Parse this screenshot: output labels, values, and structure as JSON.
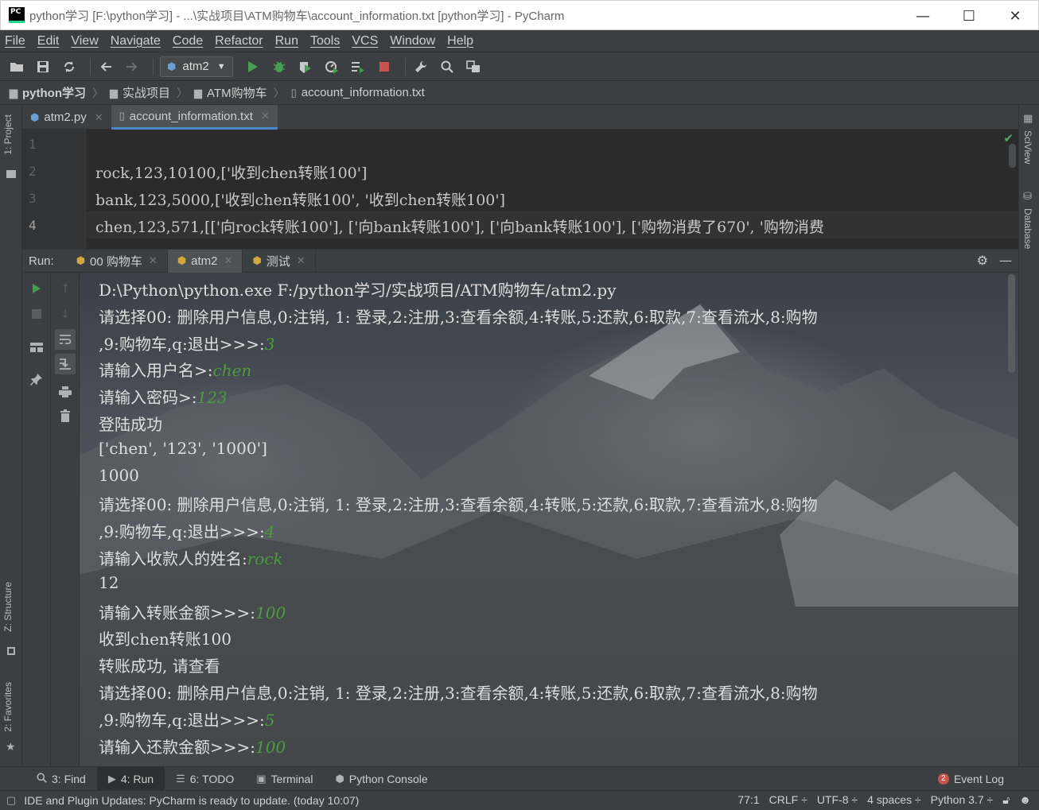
{
  "window": {
    "title": "python学习 [F:\\python学习] - ...\\实战项目\\ATM购物车\\account_information.txt [python学习] - PyCharm",
    "app_icon_text": "PC",
    "minimize": "—",
    "maximize": "☐",
    "close": "✕"
  },
  "menu": [
    "File",
    "Edit",
    "View",
    "Navigate",
    "Code",
    "Refactor",
    "Run",
    "Tools",
    "VCS",
    "Window",
    "Help"
  ],
  "toolbar": {
    "run_config": "atm2"
  },
  "breadcrumb": [
    "python学习",
    "实战项目",
    "ATM购物车",
    "account_information.txt"
  ],
  "left_strip": {
    "project": "1: Project",
    "structure": "Z: Structure",
    "favorites": "2: Favorites"
  },
  "right_strip": {
    "sciview": "SciView",
    "database": "Database"
  },
  "editor_tabs": [
    {
      "label": "atm2.py",
      "active": false
    },
    {
      "label": "account_information.txt",
      "active": true
    }
  ],
  "editor": {
    "line_numbers": [
      "1",
      "2",
      "3",
      "4"
    ],
    "lines": [
      "",
      "rock,123,10100,['收到chen转账100']",
      "bank,123,5000,['收到chen转账100', '收到chen转账100']",
      "chen,123,571,[['向rock转账100'], ['向bank转账100'], ['向bank转账100'], ['购物消费了670', '购物消费"
    ]
  },
  "run_panel": {
    "label": "Run:",
    "tabs": [
      {
        "label": "00 购物车",
        "active": false
      },
      {
        "label": "atm2",
        "active": true
      },
      {
        "label": "测试",
        "active": false
      }
    ]
  },
  "console": [
    {
      "text": "D:\\Python\\python.exe F:/python学习/实战项目/ATM购物车/atm2.py",
      "input": ""
    },
    {
      "text": "请选择00: 删除用户信息,0:注销, 1: 登录,2:注册,3:查看余额,4:转账,5:还款,6:取款,7:查看流水,8:购物",
      "input": ""
    },
    {
      "text": " ,9:购物车,q:退出>>>:",
      "input": "3"
    },
    {
      "text": "请输入用户名>:",
      "input": "chen"
    },
    {
      "text": "请输入密码>:",
      "input": "123"
    },
    {
      "text": "登陆成功",
      "input": ""
    },
    {
      "text": "['chen', '123', '1000']",
      "input": ""
    },
    {
      "text": "1000",
      "input": ""
    },
    {
      "text": "请选择00: 删除用户信息,0:注销, 1: 登录,2:注册,3:查看余额,4:转账,5:还款,6:取款,7:查看流水,8:购物",
      "input": ""
    },
    {
      "text": " ,9:购物车,q:退出>>>:",
      "input": "4"
    },
    {
      "text": "请输入收款人的姓名:",
      "input": "rock"
    },
    {
      "text": "12",
      "input": ""
    },
    {
      "text": "请输入转账金额>>>:",
      "input": "100"
    },
    {
      "text": "收到chen转账100",
      "input": ""
    },
    {
      "text": "转账成功, 请查看",
      "input": ""
    },
    {
      "text": "请选择00: 删除用户信息,0:注销, 1: 登录,2:注册,3:查看余额,4:转账,5:还款,6:取款,7:查看流水,8:购物",
      "input": ""
    },
    {
      "text": " ,9:购物车,q:退出>>>:",
      "input": "5"
    },
    {
      "text": "请输入还款金额>>>:",
      "input": "100"
    }
  ],
  "bottom_tabs": [
    {
      "label": "3: Find",
      "active": false
    },
    {
      "label": "4: Run",
      "active": true
    },
    {
      "label": "6: TODO",
      "active": false
    },
    {
      "label": "Terminal",
      "active": false
    },
    {
      "label": "Python Console",
      "active": false
    }
  ],
  "event_log": {
    "label": "Event Log",
    "count": "2"
  },
  "status": {
    "message": "IDE and Plugin Updates: PyCharm is ready to update. (today 10:07)",
    "position": "77:1",
    "line_sep": "CRLF ÷",
    "encoding": "UTF-8 ÷",
    "indent": "4 spaces ÷",
    "interpreter": "Python 3.7 ÷"
  },
  "colors": {
    "input_green": "#4c9c3e",
    "run_green": "#499c54",
    "stop_red": "#c75450",
    "accent_blue": "#4a88c7"
  }
}
